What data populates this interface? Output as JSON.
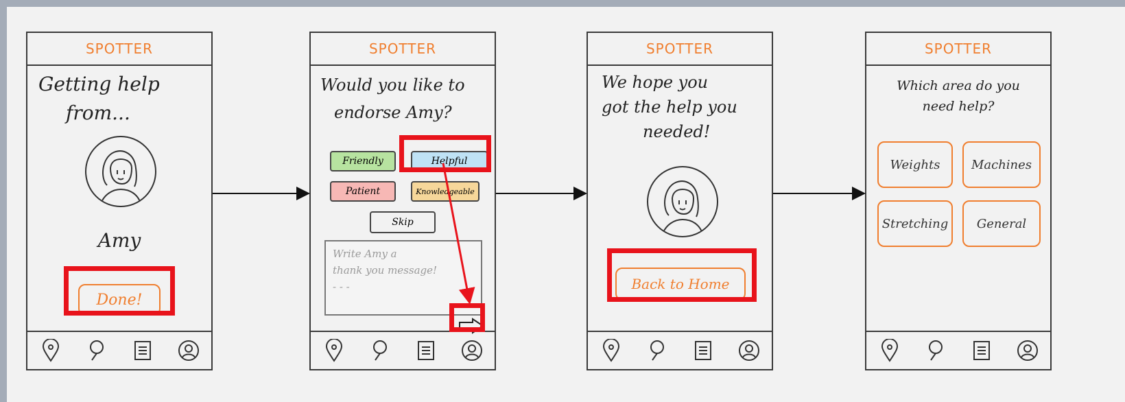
{
  "brand": "SPOTTER",
  "colors": {
    "accent": "#f07e2e",
    "highlight": "#e8131b",
    "stroke": "#3a3a3a"
  },
  "nav_icons": [
    "location-pin-icon",
    "search-icon",
    "list-icon",
    "profile-icon"
  ],
  "screen1": {
    "title_line1": "Getting help",
    "title_line2": "from...",
    "helper_name": "Amy",
    "done_label": "Done!"
  },
  "screen2": {
    "question_line1": "Would you like to",
    "question_line2": "endorse Amy?",
    "tags": {
      "friendly": "Friendly",
      "helpful": "Helpful",
      "patient": "Patient",
      "knowledgeable": "Knowledgeable"
    },
    "skip_label": "Skip",
    "message_placeholder": "Write Amy a\nthank you message!\n- - -",
    "tag_colors": {
      "friendly": "#b7e3a0",
      "helpful": "#bfe2f5",
      "patient": "#f7b8b5",
      "knowledgeable": "#f6d79a"
    }
  },
  "screen3": {
    "message_line1": "We hope you",
    "message_line2": "got the help you",
    "message_line3": "needed!",
    "back_label": "Back to Home"
  },
  "screen4": {
    "question_line1": "Which area do you",
    "question_line2": "need help?",
    "areas": [
      "Weights",
      "Machines",
      "Stretching",
      "General"
    ]
  }
}
